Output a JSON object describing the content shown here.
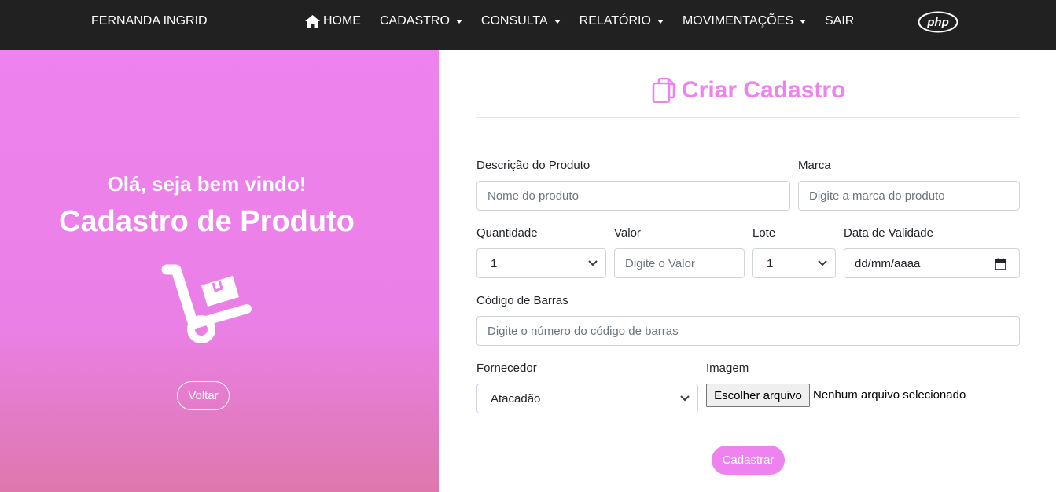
{
  "navbar": {
    "brand": "FERNANDA INGRID",
    "items": [
      {
        "label": "HOME",
        "icon": "home-icon"
      },
      {
        "label": "CADASTRO"
      },
      {
        "label": "CONSULTA"
      },
      {
        "label": "RELATÓRIO"
      },
      {
        "label": "MOVIMENTAÇÕES"
      },
      {
        "label": "SAIR"
      }
    ],
    "logo_text": "php"
  },
  "left_panel": {
    "welcome": "Olá, seja bem vindo!",
    "heading": "Cadastro de Produto",
    "icon": "hand-truck-icon",
    "back_button": "Voltar"
  },
  "form": {
    "title": "Criar Cadastro",
    "title_icon": "copy-icon",
    "accent_color": "#ee82ee",
    "fields": {
      "descricao": {
        "label": "Descrição do Produto",
        "placeholder": "Nome do produto"
      },
      "marca": {
        "label": "Marca",
        "placeholder": "Digite a marca do produto"
      },
      "quantidade": {
        "label": "Quantidade",
        "value": "1"
      },
      "valor": {
        "label": "Valor",
        "placeholder": "Digite o Valor"
      },
      "lote": {
        "label": "Lote",
        "value": "1"
      },
      "validade": {
        "label": "Data de Validade",
        "placeholder": "dd/mm/aaaa"
      },
      "codigo": {
        "label": "Código de Barras",
        "placeholder": "Digite o número do código de barras"
      },
      "fornecedor": {
        "label": "Fornecedor",
        "value": "Atacadão"
      },
      "imagem": {
        "label": "Imagem",
        "button": "Escolher arquivo",
        "status": "Nenhum arquivo selecionado"
      }
    },
    "submit": "Cadastrar"
  }
}
